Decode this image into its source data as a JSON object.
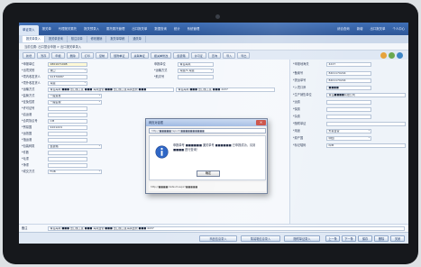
{
  "topnav": {
    "tabs": [
      "单证录入",
      "报关单",
      "代理报关委托",
      "报关预录入",
      "委托委托管理",
      "出口报关单",
      "数据查询",
      "统计",
      "系统管理"
    ],
    "active_index": 0,
    "right": [
      "综合查询",
      "新增",
      "出口报关单",
      "个人中心"
    ]
  },
  "subtabs": [
    "报关单录入",
    "报关单查询",
    "核注清单",
    "修改撤销",
    "报关单草稿",
    "通关单"
  ],
  "path": "当前位置: 出口整合申报 > 出口报关单录入",
  "toolbar": {
    "buttons": [
      "新增",
      "暂存",
      "申报",
      "删除",
      "打印",
      "复制",
      "随附单证",
      "关联单证",
      "报关单修改",
      "集装箱",
      "许可证",
      "查询",
      "导入",
      "导出"
    ]
  },
  "form": {
    "left": [
      {
        "label": "*申报单位",
        "value": "1801071098"
      },
      {
        "label": "*出境关别",
        "value": "港口"
      },
      {
        "label": "*境内收发货人",
        "value": "91370687"
      },
      {
        "label": "*境外收发货人",
        "value": "海运"
      },
      {
        "label": "*运输方式",
        "value": "青岛海关 ■■■ 出口加工区 ■■■ 海关监管 ■■■ 出口加工区海关监管 ■■■"
      },
      {
        "label": "*监管方式",
        "value": "一般贸易"
      },
      {
        "label": "*征免性质",
        "value": "一般征税"
      },
      {
        "label": "*许可证号",
        "value": ""
      },
      {
        "label": "*启运港",
        "value": ""
      },
      {
        "label": "*合同协议号",
        "value": "CM"
      },
      {
        "label": "*贸易国",
        "value": "9101224"
      },
      {
        "label": "*运抵国",
        "value": ""
      },
      {
        "label": "*指运港",
        "value": ""
      },
      {
        "label": "*包装种类",
        "value": "集装箱"
      },
      {
        "label": "*件数",
        "value": ""
      },
      {
        "label": "*毛重",
        "value": ""
      },
      {
        "label": "*净重",
        "value": ""
      },
      {
        "label": "*成交方式",
        "value": "FOB"
      }
    ],
    "mid": [
      {
        "label": "申报单位",
        "value": "青岛海关"
      },
      {
        "label": "*运输方式",
        "value": "海运/1-海运"
      },
      {
        "label": "*航次号",
        "value": ""
      },
      {
        "label": "",
        "value": "青岛海关 ■■■ 出口加工区 ■■■ 4437"
      }
    ],
    "right": [
      {
        "label": "*申报地海关",
        "value": "4227"
      },
      {
        "label": "*备案号",
        "value": "8401170244"
      },
      {
        "label": "*提运单号",
        "value": "8401170244"
      },
      {
        "label": "*入境口岸",
        "value": "■■■■"
      },
      {
        "label": "*生产销售单位",
        "value": "青岛■■■■有限公司"
      },
      {
        "label": "*运费",
        "value": ""
      },
      {
        "label": "*保费",
        "value": ""
      },
      {
        "label": "*杂费",
        "value": ""
      },
      {
        "label": "*随附单证",
        "value": ""
      },
      {
        "label": "*用途",
        "value": "外贸自营"
      },
      {
        "label": "*原产国",
        "value": "中国"
      },
      {
        "label": "*标记唛码",
        "value": "N/M"
      }
    ]
  },
  "remark": {
    "label": "备注",
    "value": "青岛海关 ■■■ 出口加工区 ■■■ 海关监管 ■■■ 出口加工区海关监管 ■■■ 4437"
  },
  "bottom": {
    "buttons": [
      "商品信息录入",
      "集装箱信息录入",
      "随附单证录入"
    ],
    "right_buttons": [
      "上一条",
      "下一条",
      "保存",
      "删除",
      "关闭"
    ]
  },
  "dialog": {
    "title": "网页对话框",
    "url": "http://■■■■■/report/■■■■■■■■■■",
    "message": "申报单号 ■■■■■■ 通关单号 ■■■■■■ 已申报成功，请到 ■■■■ 进行查询！",
    "ok_label": "确定",
    "status": "http://■■■■/default.aspx?■■■■■"
  }
}
